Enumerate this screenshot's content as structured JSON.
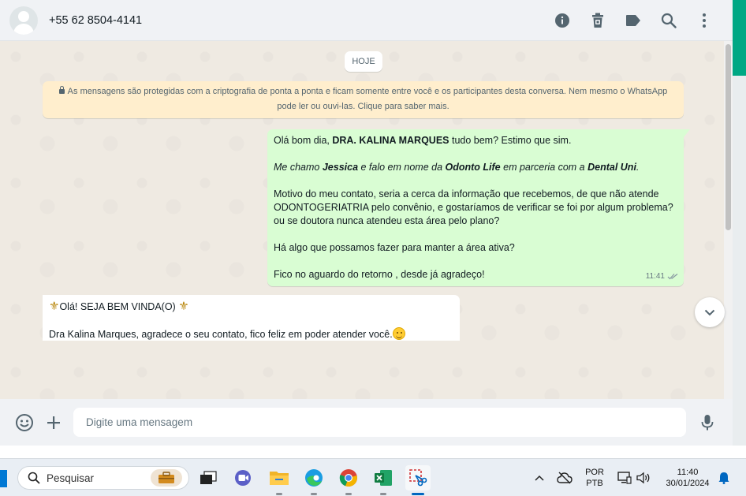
{
  "header": {
    "contact_name": "+55 62 8504-4141",
    "icons": [
      "info-icon",
      "trash-icon",
      "label-icon",
      "search-icon",
      "menu-dots-icon"
    ]
  },
  "chat": {
    "date_label": "HOJE",
    "encryption_line1": "As mensagens são protegidas com a criptografia de ponta a ponta e ficam somente entre você e os participantes desta conversa. Nem mesmo o WhatsApp",
    "encryption_line2": "pode ler ou ouvi-las. Clique para saber mais.",
    "outgoing": {
      "p1_a": "Olá bom dia, ",
      "p1_b": "DRA. KALINA MARQUES",
      "p1_c": " tudo bem? Estimo que sim.",
      "p2_a": "Me chamo ",
      "p2_b": "Jessica",
      "p2_c": " e falo em nome da ",
      "p2_d": "Odonto Life",
      "p2_e": " em parceria com a ",
      "p2_f": "Dental Uni",
      "p2_g": ".",
      "p3": "Motivo do meu contato, seria a cerca da informação que recebemos, de que não atende ODONTOGERIATRIA pelo convênio, e gostaríamos de verificar se foi por algum problema? ou se doutora nunca atendeu esta área pelo plano?",
      "p4": "Há algo que possamos fazer para manter a área ativa?",
      "p5": "Fico no aguardo do retorno , desde já agradeço!",
      "time": "11:41"
    },
    "incoming": {
      "line1": "Olá! SEJA BEM VINDA(O) ",
      "line2": "Dra Kalina Marques, agradece o seu contato, fico feliz em poder atender você."
    }
  },
  "composer": {
    "placeholder": "Digite uma mensagem"
  },
  "taskbar": {
    "search_label": "Pesquisar",
    "lang_line1": "POR",
    "lang_line2": "PTB",
    "time": "11:40",
    "date": "30/01/2024"
  },
  "colors": {
    "accent": "#00a884",
    "outgoing_bubble": "#d9fdd3",
    "encryption_bg": "#ffeecd"
  }
}
